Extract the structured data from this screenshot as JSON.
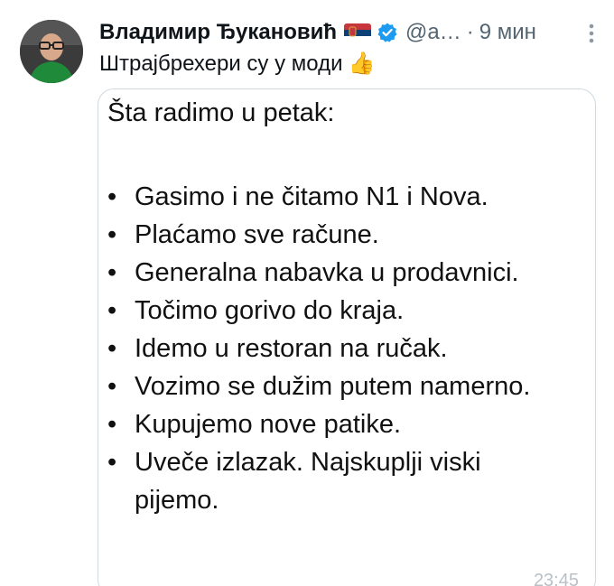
{
  "author": {
    "name": "Владимир Ђукановић",
    "flag_icon": "serbia-flag-icon",
    "verified_icon": "verified-badge-icon",
    "handle": "@a…",
    "separator": "·",
    "time": "9 мин"
  },
  "tweet": {
    "text": "Штрајбрехери су у моди",
    "emoji": "👍"
  },
  "media": {
    "title": "Šta radimo u petak:",
    "items": [
      "Gasimo i ne čitamo N1 i Nova.",
      "Plaćamo sve račune.",
      "Generalna nabavka u prodavnici.",
      "Točimo gorivo do kraja.",
      "Idemo u restoran na ručak.",
      "Vozimo se dužim putem namerno.",
      "Kupujemo nove patike.",
      "Uveče izlazak. Najskuplji viski pijemo."
    ],
    "bullet": "•",
    "corner_time": "23:45"
  },
  "colors": {
    "verified": "#1d9bf0",
    "secondary_text": "#536471",
    "border": "#cfd9de"
  }
}
